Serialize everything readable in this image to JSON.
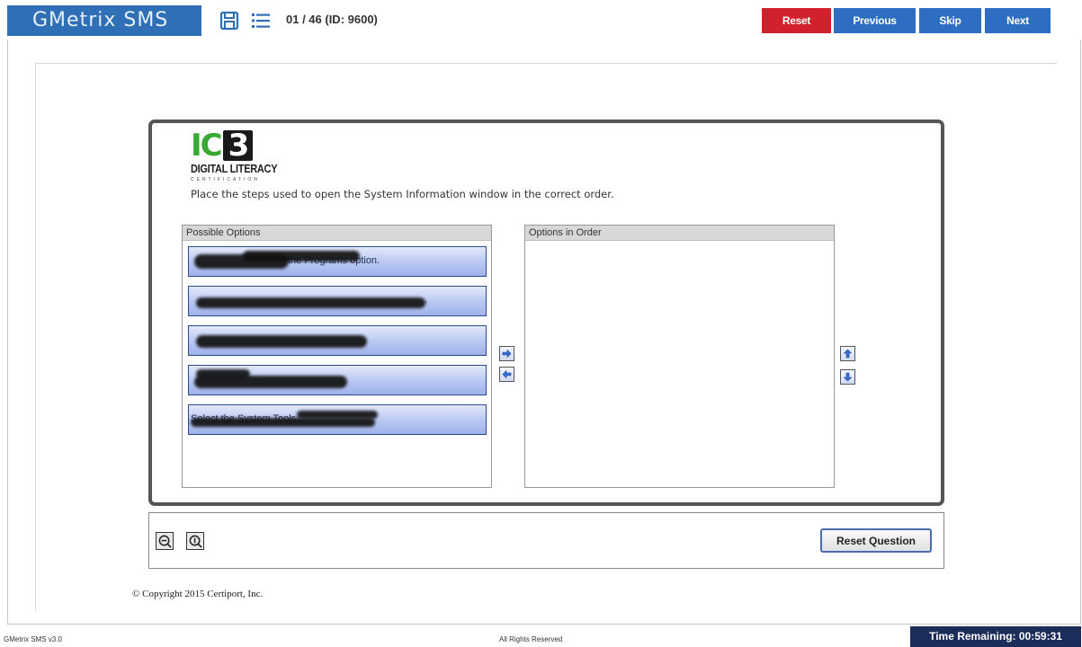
{
  "app": {
    "brand": "GMetrix SMS",
    "counter": "01 / 46 (ID: 9600)",
    "icons": [
      "save-icon",
      "list-icon"
    ]
  },
  "nav": {
    "reset": "Reset",
    "previous": "Previous",
    "skip": "Skip",
    "next": "Next"
  },
  "colors": {
    "brand": "#2f6fb5",
    "reset": "#d2202c",
    "nav": "#2d6ec2",
    "timer_bg": "#1c2d5a",
    "logo_green": "#39a935"
  },
  "logo": {
    "ic": "IC",
    "three": "3",
    "title": "DIGITAL LITERACY",
    "subtitle": "CERTIFICATION"
  },
  "question": {
    "text": "Place the steps used to open the System Information window in the correct order."
  },
  "possible_options": {
    "header": "Possible Options",
    "items": [
      {
        "label": "the Programs option."
      },
      {
        "label": "."
      },
      {
        "label": "."
      },
      {
        "label": ""
      },
      {
        "label": "Select the System Tools ."
      }
    ]
  },
  "options_in_order": {
    "header": "Options in Order",
    "items": []
  },
  "toolbar": {
    "reset_question": "Reset Question"
  },
  "copyright": "© Copyright 2015 Certiport, Inc.",
  "footer": {
    "version": "GMetrix SMS v3.0",
    "rights": "All Rights Reserved",
    "time_remaining": "Time Remaining: 00:59:31"
  }
}
